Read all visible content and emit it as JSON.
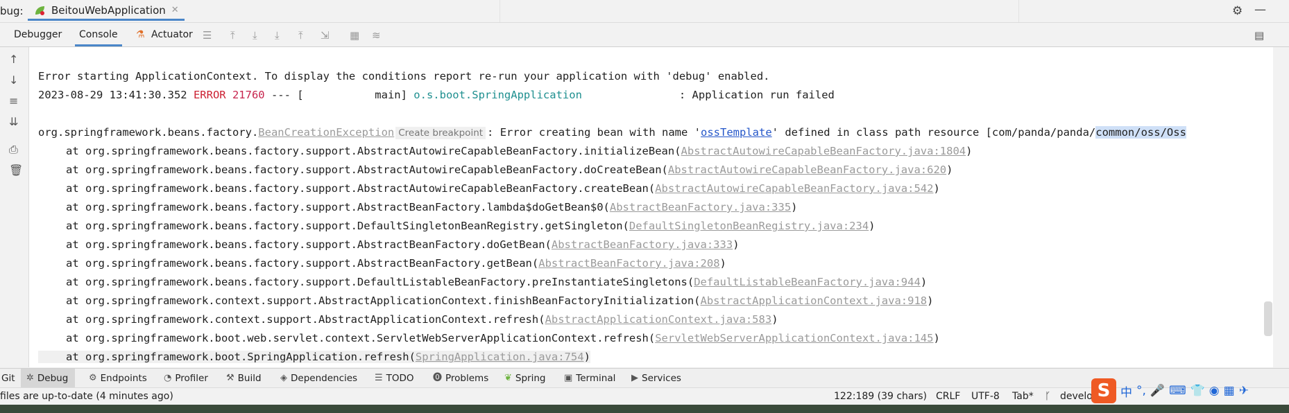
{
  "titlebar": {
    "debug_label": "bug:",
    "run_tab": "BeitouWebApplication",
    "settings_icon": "gear-icon",
    "minimize_icon": "minimize-icon"
  },
  "toolbar": {
    "tabs": [
      "Debugger",
      "Console",
      "Actuator"
    ],
    "active_tab": "Console"
  },
  "console": {
    "line1": "Error starting ApplicationContext. To display the conditions report re-run your application with 'debug' enabled.",
    "l2_time": "2023-08-29 13:41:30.352 ",
    "l2_level": "ERROR",
    "l2_pid": " 21760",
    "l2_mid": " --- [           main] ",
    "l2_logger": "o.s.boot.SpringApplication",
    "l2_msg": "               : Application run failed",
    "l3_pre": "org.springframework.beans.factory.",
    "l3_exc": "BeanCreationException",
    "l3_tip": "Create breakpoint",
    "l3_mid": ": Error creating bean with name '",
    "l3_bean": "ossTemplate",
    "l3_post": "' defined in class path resource [com/panda/panda/",
    "l3_hl": "common/oss/Oss",
    "stack": [
      {
        "text": "at org.springframework.beans.factory.support.AbstractAutowireCapableBeanFactory.initializeBean(",
        "link": "AbstractAutowireCapableBeanFactory.java:1804"
      },
      {
        "text": "at org.springframework.beans.factory.support.AbstractAutowireCapableBeanFactory.doCreateBean(",
        "link": "AbstractAutowireCapableBeanFactory.java:620"
      },
      {
        "text": "at org.springframework.beans.factory.support.AbstractAutowireCapableBeanFactory.createBean(",
        "link": "AbstractAutowireCapableBeanFactory.java:542"
      },
      {
        "text": "at org.springframework.beans.factory.support.AbstractBeanFactory.lambda$doGetBean$0(",
        "link": "AbstractBeanFactory.java:335"
      },
      {
        "text": "at org.springframework.beans.factory.support.DefaultSingletonBeanRegistry.getSingleton(",
        "link": "DefaultSingletonBeanRegistry.java:234"
      },
      {
        "text": "at org.springframework.beans.factory.support.AbstractBeanFactory.doGetBean(",
        "link": "AbstractBeanFactory.java:333"
      },
      {
        "text": "at org.springframework.beans.factory.support.AbstractBeanFactory.getBean(",
        "link": "AbstractBeanFactory.java:208"
      },
      {
        "text": "at org.springframework.beans.factory.support.DefaultListableBeanFactory.preInstantiateSingletons(",
        "link": "DefaultListableBeanFactory.java:944"
      },
      {
        "text": "at org.springframework.context.support.AbstractApplicationContext.finishBeanFactoryInitialization(",
        "link": "AbstractApplicationContext.java:918"
      },
      {
        "text": "at org.springframework.context.support.AbstractApplicationContext.refresh(",
        "link": "AbstractApplicationContext.java:583"
      },
      {
        "text": "at org.springframework.boot.web.servlet.context.ServletWebServerApplicationContext.refresh(",
        "link": "ServletWebServerApplicationContext.java:145"
      },
      {
        "text": "at org.springframework.boot.SpringApplication.refresh(",
        "link": "SpringApplication.java:754"
      }
    ],
    "close_paren": ")"
  },
  "tooltabs": [
    "Git",
    "Debug",
    "Endpoints",
    "Profiler",
    "Build",
    "Dependencies",
    "TODO",
    "Problems",
    "Spring",
    "Terminal",
    "Services"
  ],
  "statusbar": {
    "message": "files are up-to-date (4 minutes ago)",
    "position": "122:189 (39 chars)",
    "line_sep": "CRLF",
    "encoding": "UTF-8",
    "indent": "Tab*",
    "branch": "develo"
  },
  "ime": {
    "logo": "S",
    "glyph": "中"
  }
}
